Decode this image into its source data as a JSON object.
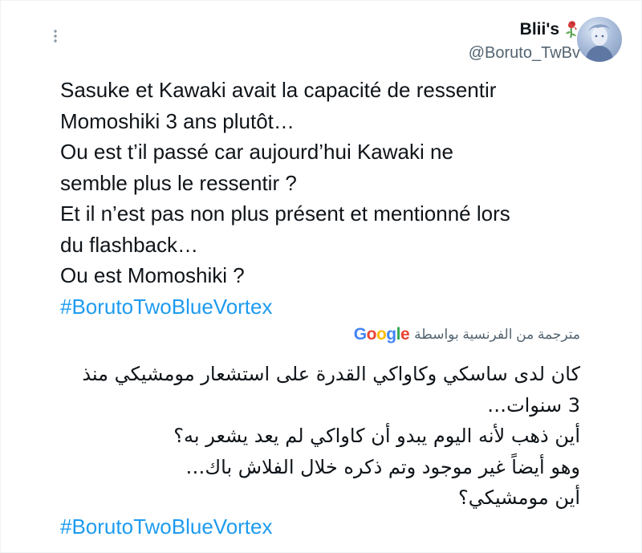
{
  "author": {
    "display_name": "Blii's",
    "handle": "@Boruto_TwBv",
    "emoji_icon": "wilted-rose-icon"
  },
  "tweet": {
    "lines": [
      "Sasuke et Kawaki avait la capacité de ressentir",
      "Momoshiki 3 ans plutôt…",
      "Ou est t’il passé car aujourd’hui Kawaki ne",
      "semble plus le ressentir ?",
      "Et il n’est pas non plus présent et mentionné lors",
      "du flashback…",
      "Ou est Momoshiki ?"
    ],
    "hashtag": "#BorutoTwoBlueVortex"
  },
  "translation": {
    "label": "مترجمة من الفرنسية بواسطة",
    "provider": "Google",
    "lines": [
      "كان لدى ساسكي وكاواكي القدرة على استشعار مومشيكي منذ",
      "3 سنوات…",
      "أين ذهب لأنه اليوم يبدو أن كاواكي لم يعد يشعر به؟",
      "وهو أيضاً غير موجود وتم ذكره خلال الفلاش باك…",
      "أين مومشيكي؟"
    ],
    "hashtag": "#BorutoTwoBlueVortex"
  },
  "icons": {
    "more": "more-vertical-icon",
    "avatar": "avatar-image"
  },
  "colors": {
    "hashtag": "#1d9bf0",
    "secondary_text": "#536471",
    "primary_text": "#0f1419"
  }
}
